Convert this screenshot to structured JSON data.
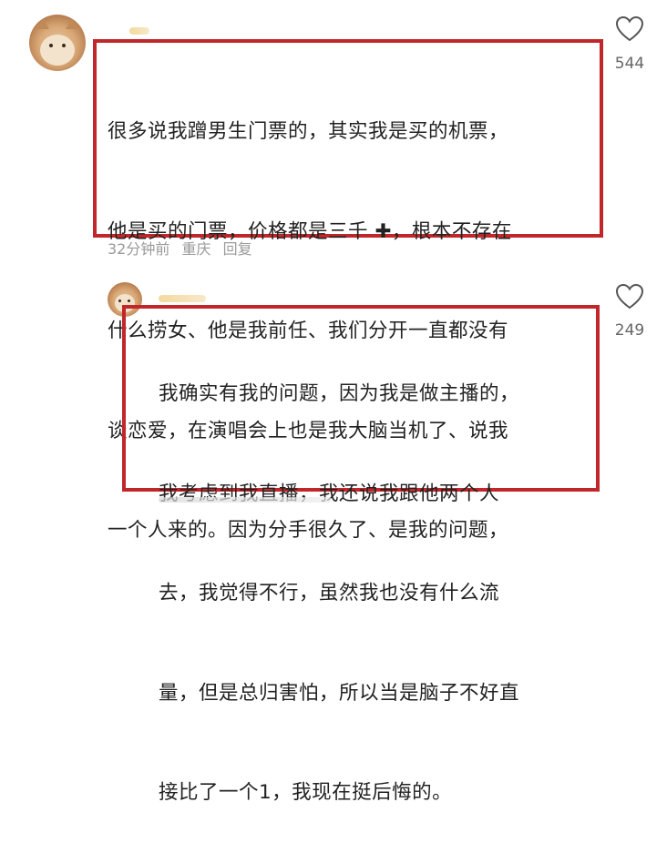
{
  "comments": [
    {
      "likes": "544",
      "lines": [
        "很多说我蹭男生门票的，其实我是买的机票，",
        "他是买的门票，价格都是三千 ✚，根本不存在",
        "什么捞女、他是我前任、我们分开一直都没有",
        "谈恋爱，在演唱会上也是我大脑当机了、说我",
        "一个人来的。因为分手很久了、是我的问题，"
      ],
      "meta": {
        "time": "32分钟前",
        "location": "重庆",
        "reply": "回复"
      }
    },
    {
      "likes": "249",
      "lines": [
        "我确实有我的问题，因为我是做主播的，",
        "我考虑到我直播，我还说我跟他两个人",
        "去，我觉得不行，虽然我也没有什么流",
        "量，但是总归害怕，所以当是脑子不好直",
        "接比了一个1，我现在挺后悔的。"
      ]
    }
  ],
  "colors": {
    "highlight_border": "#c0262a",
    "meta_text": "#9a9a9a"
  },
  "icons": {
    "like": "heart-outline-icon"
  }
}
